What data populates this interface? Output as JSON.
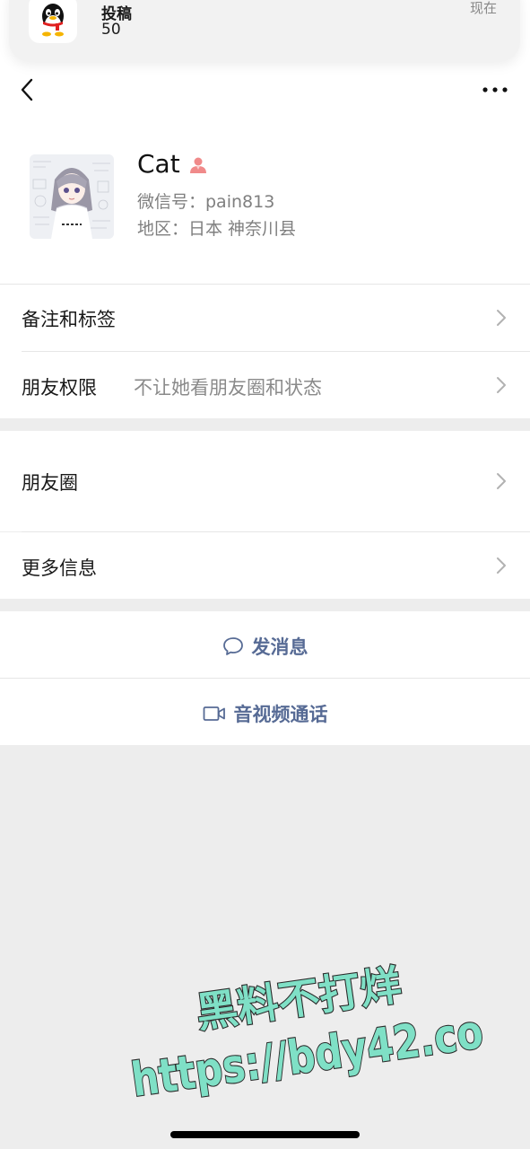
{
  "notification": {
    "title": "投稿",
    "count": "50",
    "time": "现在"
  },
  "profile": {
    "name": "Cat",
    "wechat_id": "微信号：pain813",
    "region": "地区：日本 神奈川县"
  },
  "rows": {
    "remarks_label": "备注和标签",
    "permissions_label": "朋友权限",
    "permissions_value": "不让她看朋友圈和状态",
    "moments_label": "朋友圈",
    "more_info_label": "更多信息"
  },
  "actions": {
    "message_label": "发消息",
    "call_label": "音视频通话"
  },
  "watermark": {
    "line1": "黑料不打烊",
    "line2": "https://bdy42.co"
  },
  "colors": {
    "link_blue": "#576b95",
    "watermark_fill": "#7fe0c6",
    "female_badge": "#f08a8a"
  }
}
